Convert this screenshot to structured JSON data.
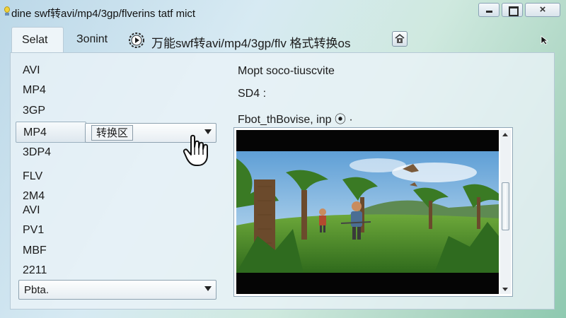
{
  "window": {
    "title": "dine swf转avi/mp4/3gp/flverins tatf mict",
    "close_glyph": "×"
  },
  "tabs": {
    "items": [
      {
        "label": "Selat"
      },
      {
        "label": "Зoпint"
      }
    ],
    "page_title": "万能swf转avi/mp4/3gp/flv 格式转换os"
  },
  "formats": {
    "items": [
      {
        "label": "AVI"
      },
      {
        "label": "MP4"
      },
      {
        "label": "3GP"
      },
      {
        "label": "MP4"
      },
      {
        "label": "3DP4"
      },
      {
        "label": "FLV"
      },
      {
        "label": "2M4"
      },
      {
        "label": "AVI"
      },
      {
        "label": "PV1"
      },
      {
        "label": "MBF"
      },
      {
        "label": "2211"
      }
    ],
    "selected_index": 3,
    "convert_combo": {
      "label": "转换区"
    },
    "output_combo": {
      "value": "Pbta."
    }
  },
  "info": {
    "title": "Mopt soco-tiuscvite",
    "subtitle": "SD4 :",
    "description": "Fbot_thBovise, inp ⦿ ·"
  },
  "preview": {
    "scrollbar_position": 0.35
  },
  "icons": {
    "app": "lightbulb-icon",
    "play": "play-circle-icon",
    "lock": "lock-icon",
    "cursor": "arrow-cursor-icon",
    "hand": "hand-cursor-icon"
  }
}
